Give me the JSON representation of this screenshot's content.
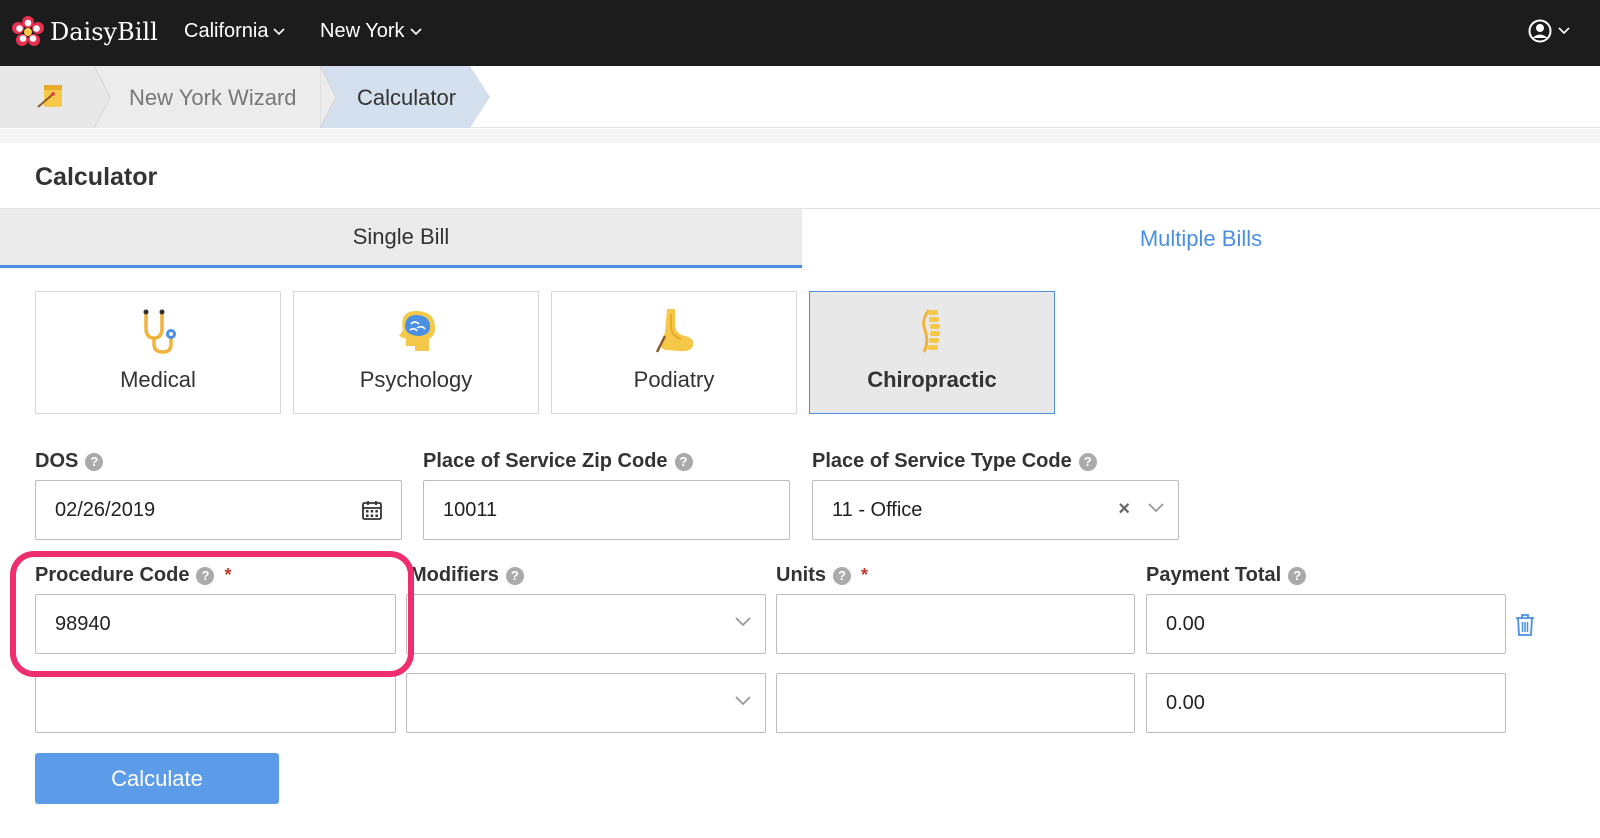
{
  "navbar": {
    "brand": "DaisyBill",
    "menus": [
      {
        "label": "California"
      },
      {
        "label": "New York"
      }
    ]
  },
  "breadcrumb": {
    "items": [
      {
        "label": "New York Wizard"
      },
      {
        "label": "Calculator"
      }
    ]
  },
  "page": {
    "title": "Calculator"
  },
  "tabs": [
    {
      "label": "Single Bill",
      "active": true
    },
    {
      "label": "Multiple Bills",
      "active": false
    }
  ],
  "specialties": [
    {
      "label": "Medical",
      "icon": "stethoscope-icon"
    },
    {
      "label": "Psychology",
      "icon": "brain-icon"
    },
    {
      "label": "Podiatry",
      "icon": "foot-icon"
    },
    {
      "label": "Chiropractic",
      "icon": "spine-icon",
      "active": true
    }
  ],
  "form": {
    "dos": {
      "label": "DOS",
      "value": "02/26/2019"
    },
    "zip": {
      "label": "Place of Service Zip Code",
      "value": "10011"
    },
    "pos_type": {
      "label": "Place of Service Type Code",
      "value": "11 - Office"
    },
    "procedure_label": "Procedure Code",
    "modifiers_label": "Modifiers",
    "units_label": "Units",
    "payment_label": "Payment Total",
    "required_mark": "*",
    "rows": [
      {
        "procedure": "98940",
        "modifiers": "",
        "units": "",
        "payment": "0.00"
      },
      {
        "procedure": "",
        "modifiers": "",
        "units": "",
        "payment": "0.00"
      }
    ]
  },
  "actions": {
    "calculate_label": "Calculate"
  },
  "colors": {
    "accent": "#4a90e2",
    "button": "#5b9be8",
    "highlight": "#ee2e6e",
    "navbar": "#1c1c1c"
  }
}
